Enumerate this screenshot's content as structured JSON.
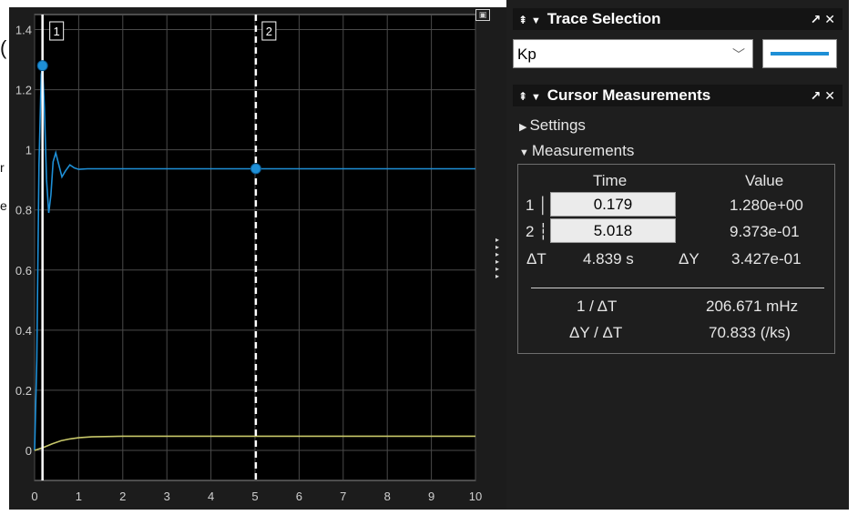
{
  "background_glyphs": {
    "g1": "(",
    "g2": "r",
    "g3": "e"
  },
  "plot": {
    "cursor1_label": "1",
    "cursor2_label": "2",
    "xlim": [
      0,
      10
    ],
    "ylim": [
      -0.1,
      1.45
    ],
    "x_ticks": [
      0,
      1,
      2,
      3,
      4,
      5,
      6,
      7,
      8,
      9,
      10
    ],
    "y_ticks": [
      0,
      0.2,
      0.4,
      0.6,
      0.8,
      1,
      1.2,
      1.4
    ],
    "x_tick_labels": [
      "0",
      "1",
      "2",
      "3",
      "4",
      "5",
      "6",
      "7",
      "8",
      "9",
      "10"
    ],
    "y_tick_labels": [
      "0",
      "0.2",
      "0.4",
      "0.6",
      "0.8",
      "1",
      "1.2",
      "1.4"
    ],
    "cursor1_x": 0.179,
    "cursor2_x": 5.018,
    "colors": {
      "background": "#000000",
      "grid": "#4a4a4a",
      "kp_trace": "#1e8fd6",
      "second_trace": "#c8c86a",
      "cursor": "#ffffff"
    },
    "series": [
      {
        "color": "#1e8fd6",
        "x": [
          0,
          0.05,
          0.1,
          0.15,
          0.179,
          0.22,
          0.27,
          0.32,
          0.37,
          0.42,
          0.48,
          0.55,
          0.62,
          0.7,
          0.8,
          0.9,
          1.0,
          1.2,
          1.5,
          2,
          3,
          4,
          5,
          6,
          7,
          8,
          9,
          10
        ],
        "y": [
          0,
          0.3,
          0.95,
          1.25,
          1.28,
          1.15,
          0.9,
          0.79,
          0.85,
          0.96,
          0.99,
          0.95,
          0.91,
          0.93,
          0.95,
          0.94,
          0.935,
          0.937,
          0.937,
          0.937,
          0.937,
          0.937,
          0.937,
          0.937,
          0.937,
          0.937,
          0.937,
          0.937
        ]
      },
      {
        "color": "#c8c86a",
        "x": [
          0,
          0.2,
          0.4,
          0.6,
          0.8,
          1.0,
          1.3,
          1.6,
          2,
          3,
          4,
          5,
          6,
          7,
          8,
          9,
          10
        ],
        "y": [
          0,
          0.01,
          0.022,
          0.032,
          0.038,
          0.042,
          0.045,
          0.046,
          0.047,
          0.047,
          0.047,
          0.047,
          0.047,
          0.047,
          0.047,
          0.047,
          0.047
        ]
      }
    ]
  },
  "trace_selection": {
    "title": "Trace Selection",
    "selected": "Kp",
    "line_color": "#1e8fd6"
  },
  "cursor_measurements": {
    "title": "Cursor Measurements",
    "settings_label": "Settings",
    "measurements_label": "Measurements",
    "time_header": "Time",
    "value_header": "Value",
    "row1_label": "1",
    "row1_time": "0.179",
    "row1_value": "1.280e+00",
    "row2_label": "2",
    "row2_time": "5.018",
    "row2_value": "9.373e-01",
    "delta_t_label": "ΔT",
    "delta_t_value": "4.839 s",
    "delta_y_label": "ΔY",
    "delta_y_value": "3.427e-01",
    "inv_dt_label": "1 / ΔT",
    "inv_dt_value": "206.671 mHz",
    "slope_label": "ΔY / ΔT",
    "slope_value": "70.833 (/ks)"
  }
}
